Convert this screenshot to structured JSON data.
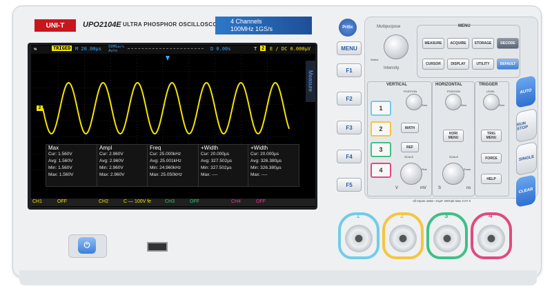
{
  "brand": {
    "logo": "UNI-T",
    "model": "UPO2104E",
    "description": "ULTRA PHOSPHOR OSCILLOSCOPE",
    "channels": "4 Channels",
    "spec": "100MHz 1GS/s"
  },
  "status": {
    "trig": "TRIGED",
    "timebase": "M 20.00µs",
    "sample": "50MSa/s",
    "mode": "Auto",
    "delay": "D 0.00s",
    "trig_label": "T",
    "trig_ch": "2",
    "trig_info": "E / DC 0.000µV"
  },
  "measurements": [
    {
      "title": "Max",
      "cur": "Cur: 1.560V",
      "avg": "Avg: 1.560V",
      "min": "Min: 1.560V",
      "max": "Max: 1.560V"
    },
    {
      "title": "Ampl",
      "cur": "Cur: 2.960V",
      "avg": "Avg: 2.960V",
      "min": "Min: 2.960V",
      "max": "Max: 2.960V"
    },
    {
      "title": "Freq",
      "cur": "Cur: 25.000kHz",
      "avg": "Avg: 25.001kHz",
      "min": "Min: 24.960kHz",
      "max": "Max: 25.050kHz"
    },
    {
      "title": "+Width",
      "cur": "Cur: 20.000µs",
      "avg": "Avg: 327.502µs",
      "min": "Min: 327.502µs",
      "max": "Max: ----"
    },
    {
      "title": "+Width",
      "cur": "Cur: 20.000µs",
      "avg": "Avg: 326.380µs",
      "min": "Min: 326.380µs",
      "max": "Max: ----"
    }
  ],
  "channel_bar": [
    {
      "name": "CH1",
      "state": "OFF",
      "color": "#f6e600"
    },
    {
      "name": "CH2",
      "state": "C — 100V fe",
      "color": "#f6e600"
    },
    {
      "name": "CH3",
      "state": "OFF",
      "color": "#2ecc71"
    },
    {
      "name": "CH4",
      "state": "OFF",
      "color": "#ff2fa0"
    }
  ],
  "side_menu_label": "Measure",
  "soft_keys": [
    "PrtSc",
    "MENU",
    "F1",
    "F2",
    "F3",
    "F4",
    "F5"
  ],
  "panel": {
    "multipurpose": "Multipurpose",
    "select": "Select",
    "intensity": "Intensity",
    "menu_title": "MENU",
    "menu_buttons": [
      "MEASURE",
      "ACQUIRE",
      "STORAGE",
      "DECODE",
      "CURSOR",
      "DISPLAY",
      "UTILITY",
      "DEFAULT"
    ],
    "vertical": "VERTICAL",
    "horizontal": "HORIZONTAL",
    "trigger": "TRIGGER",
    "position": "POSITION",
    "level": "LEVEL",
    "zero": "Zero",
    "fine": "Fine",
    "scale": "SCALE",
    "zoom": "Zoom",
    "math": "MATH",
    "ref": "REF",
    "hori_menu": "HORI MENU",
    "trig_menu": "TRIG MENU",
    "force": "FORCE",
    "help": "HELP",
    "v": "V",
    "mv": "mV",
    "s": "S",
    "ns": "ns",
    "channels": [
      "1",
      "2",
      "3",
      "4"
    ],
    "side": [
      "AUTO",
      "RUN STOP",
      "SINGLE",
      "CLEAR"
    ],
    "inputs_note": "All Inputs 1MΩ—21pF 400Vpk Max CAT II"
  },
  "channel_colors": {
    "ch1": "#6fcde6",
    "ch2": "#f5c542",
    "ch3": "#3fbf86",
    "ch4": "#e04a7c"
  }
}
